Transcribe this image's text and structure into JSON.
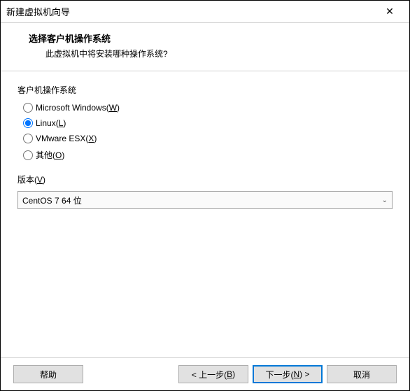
{
  "titlebar": {
    "title": "新建虚拟机向导"
  },
  "header": {
    "heading": "选择客户机操作系统",
    "subtext": "此虚拟机中将安装哪种操作系统?"
  },
  "os_group": {
    "label": "客户机操作系统",
    "options": [
      {
        "label": "Microsoft Windows(",
        "accel": "W",
        "suffix": ")",
        "checked": false
      },
      {
        "label": "Linux(",
        "accel": "L",
        "suffix": ")",
        "checked": true
      },
      {
        "label": "VMware ESX(",
        "accel": "X",
        "suffix": ")",
        "checked": false
      },
      {
        "label": "其他(",
        "accel": "O",
        "suffix": ")",
        "checked": false
      }
    ]
  },
  "version": {
    "label_pre": "版本(",
    "label_accel": "V",
    "label_suf": ")",
    "selected": "CentOS 7 64 位"
  },
  "buttons": {
    "help": "帮助",
    "back_pre": "< 上一步(",
    "back_accel": "B",
    "back_suf": ")",
    "next_pre": "下一步(",
    "next_accel": "N",
    "next_suf": ") >",
    "cancel": "取消"
  }
}
